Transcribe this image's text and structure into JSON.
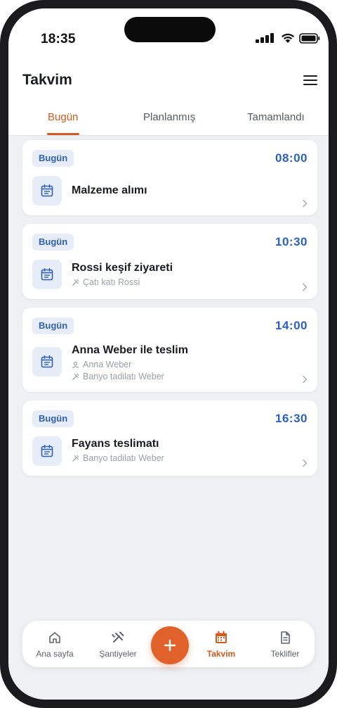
{
  "status_bar": {
    "time": "18:35"
  },
  "header": {
    "title": "Takvim"
  },
  "tabs": [
    {
      "label": "Bugün",
      "active": true
    },
    {
      "label": "Planlanmış",
      "active": false
    },
    {
      "label": "Tamamlandı",
      "active": false
    }
  ],
  "appointments": [
    {
      "badge": "Bugün",
      "time": "08:00",
      "title": "Malzeme alımı"
    },
    {
      "badge": "Bugün",
      "time": "10:30",
      "title": "Rossi keşif ziyareti",
      "project": "Çatı katı Rossi"
    },
    {
      "badge": "Bugün",
      "time": "14:00",
      "title": "Anna Weber ile teslim",
      "client": "Anna Weber",
      "project": "Banyo tadilatı Weber"
    },
    {
      "badge": "Bugün",
      "time": "16:30",
      "title": "Fayans teslimatı",
      "project": "Banyo tadilatı Weber"
    }
  ],
  "bottom_nav": [
    {
      "label": "Ana sayfa",
      "icon": "home-icon"
    },
    {
      "label": "Şantiyeler",
      "icon": "tools-icon"
    },
    {
      "label": "Takvim",
      "icon": "calendar-icon",
      "active": true
    },
    {
      "label": "Teklifler",
      "icon": "document-icon"
    }
  ],
  "fab": {
    "icon": "plus-icon"
  },
  "colors": {
    "accent": "#d35a1e",
    "fab": "#e0622a",
    "blue": "#2b5fc4",
    "badge_bg": "#e6edf8",
    "background": "#eef0f3"
  }
}
